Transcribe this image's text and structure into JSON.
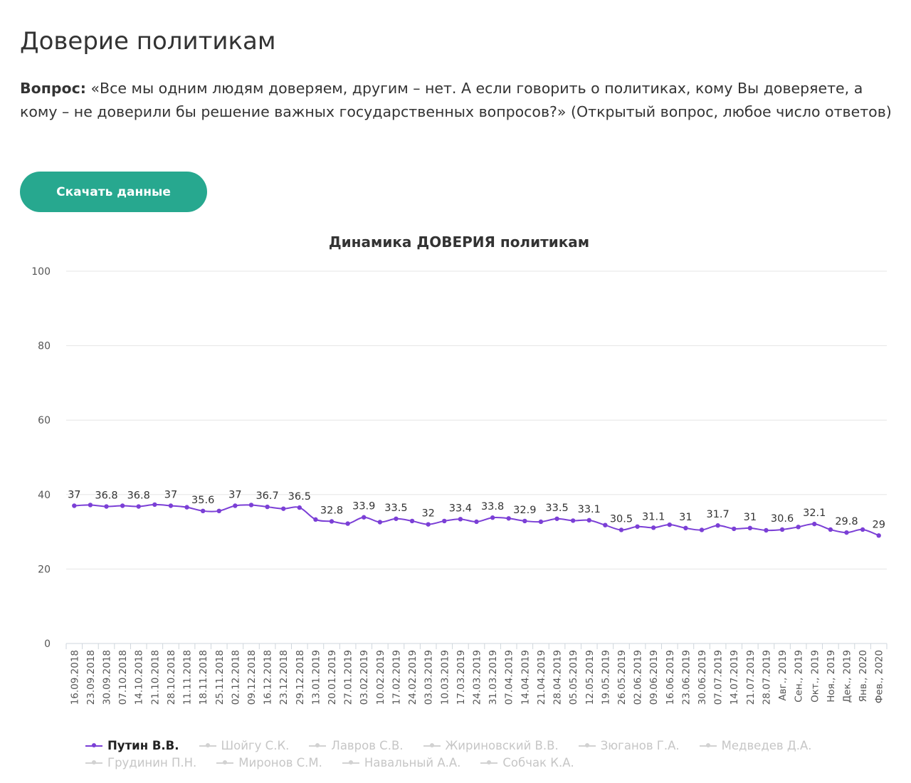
{
  "header": {
    "title": "Доверие политикам",
    "question_label": "Вопрос:",
    "question_text": " «Все мы одним людям доверяем, другим – нет. А если говорить о политиках, кому Вы доверяете, а кому – не доверили бы решение важных государственных вопросов?» (Открытый вопрос, любое число ответов)",
    "download_label": "Скачать данные"
  },
  "colors": {
    "accent": "#27a88f",
    "series_active": "#7b3fd6",
    "series_inactive": "#d2d2d2",
    "grid": "#e6e6e6"
  },
  "chart_data": {
    "type": "line",
    "title": "Динамика ДОВЕРИЯ политикам",
    "xlabel": "",
    "ylabel": "",
    "ylim": [
      0,
      100
    ],
    "yticks": [
      0,
      20,
      40,
      60,
      80,
      100
    ],
    "grid": true,
    "legend_position": "bottom",
    "x": [
      "16.09.2018",
      "23.09.2018",
      "30.09.2018",
      "07.10.2018",
      "14.10.2018",
      "21.10.2018",
      "28.10.2018",
      "11.11.2018",
      "18.11.2018",
      "25.11.2018",
      "02.12.2018",
      "09.12.2018",
      "16.12.2018",
      "23.12.2018",
      "29.12.2018",
      "13.01.2019",
      "20.01.2019",
      "27.01.2019",
      "03.02.2019",
      "10.02.2019",
      "17.02.2019",
      "24.02.2019",
      "03.03.2019",
      "10.03.2019",
      "17.03.2019",
      "24.03.2019",
      "31.03.2019",
      "07.04.2019",
      "14.04.2019",
      "21.04.2019",
      "28.04.2019",
      "05.05.2019",
      "12.05.2019",
      "19.05.2019",
      "26.05.2019",
      "02.06.2019",
      "09.06.2019",
      "16.06.2019",
      "23.06.2019",
      "30.06.2019",
      "07.07.2019",
      "14.07.2019",
      "21.07.2019",
      "28.07.2019",
      "Авг., 2019",
      "Сен., 2019",
      "Окт., 2019",
      "Ноя., 2019",
      "Дек., 2019",
      "Янв., 2020",
      "Фев., 2020"
    ],
    "series": [
      {
        "name": "Путин В.В.",
        "active": true,
        "values": [
          37,
          37.2,
          36.8,
          37,
          36.8,
          37.3,
          37,
          36.6,
          35.6,
          35.6,
          37,
          37.2,
          36.7,
          36.2,
          36.5,
          33.3,
          32.8,
          32.2,
          33.9,
          32.6,
          33.5,
          32.9,
          32,
          32.9,
          33.4,
          32.7,
          33.8,
          33.6,
          32.9,
          32.7,
          33.5,
          33.0,
          33.1,
          31.8,
          30.5,
          31.4,
          31.1,
          31.9,
          31,
          30.5,
          31.7,
          30.8,
          31,
          30.4,
          30.6,
          31.3,
          32.1,
          30.6,
          29.8,
          30.6,
          29
        ],
        "labels": [
          {
            "index": 0,
            "text": "37"
          },
          {
            "index": 2,
            "text": "36.8"
          },
          {
            "index": 4,
            "text": "36.8"
          },
          {
            "index": 6,
            "text": "37"
          },
          {
            "index": 8,
            "text": "35.6"
          },
          {
            "index": 10,
            "text": "37"
          },
          {
            "index": 12,
            "text": "36.7"
          },
          {
            "index": 14,
            "text": "36.5"
          },
          {
            "index": 16,
            "text": "32.8"
          },
          {
            "index": 18,
            "text": "33.9"
          },
          {
            "index": 20,
            "text": "33.5"
          },
          {
            "index": 22,
            "text": "32"
          },
          {
            "index": 24,
            "text": "33.4"
          },
          {
            "index": 26,
            "text": "33.8"
          },
          {
            "index": 28,
            "text": "32.9"
          },
          {
            "index": 30,
            "text": "33.5"
          },
          {
            "index": 32,
            "text": "33.1"
          },
          {
            "index": 34,
            "text": "30.5"
          },
          {
            "index": 36,
            "text": "31.1"
          },
          {
            "index": 38,
            "text": "31"
          },
          {
            "index": 40,
            "text": "31.7"
          },
          {
            "index": 42,
            "text": "31"
          },
          {
            "index": 44,
            "text": "30.6"
          },
          {
            "index": 46,
            "text": "32.1"
          },
          {
            "index": 48,
            "text": "29.8"
          },
          {
            "index": 50,
            "text": "29"
          }
        ]
      },
      {
        "name": "Шойгу С.К.",
        "active": false
      },
      {
        "name": "Лавров С.В.",
        "active": false
      },
      {
        "name": "Жириновский В.В.",
        "active": false
      },
      {
        "name": "Зюганов Г.А.",
        "active": false
      },
      {
        "name": "Медведев Д.А.",
        "active": false
      },
      {
        "name": "Грудинин П.Н.",
        "active": false
      },
      {
        "name": "Миронов С.М.",
        "active": false
      },
      {
        "name": "Навальный А.А.",
        "active": false
      },
      {
        "name": "Собчак К.А.",
        "active": false
      }
    ]
  }
}
